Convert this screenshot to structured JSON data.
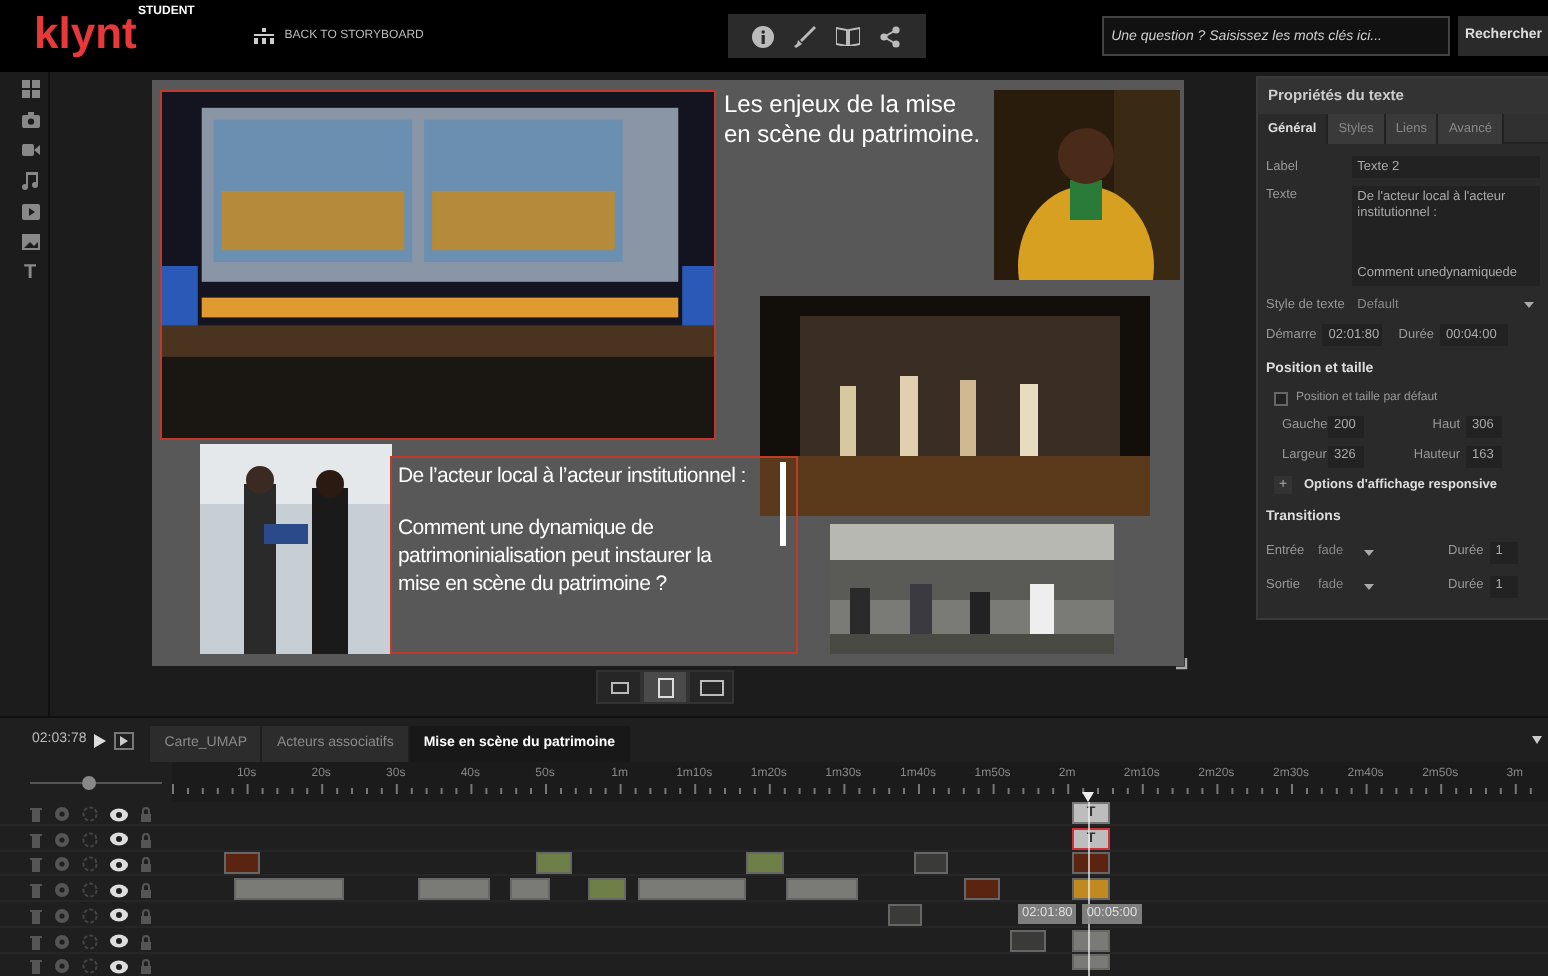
{
  "top_bar": {
    "logo": "klynt",
    "logo_badge": "STUDENT",
    "back_link": "BACK TO STORYBOARD",
    "search": {
      "placeholder": "Une question ? Saisissez les mots clés ici..."
    },
    "search_button": "Rechercher"
  },
  "tool_strip": {
    "text_tool": "T"
  },
  "stage": {
    "title": "Les enjeux de la mise en scène du patrimoine.",
    "text_block": {
      "selected": true,
      "paragraphs": [
        "De l’acteur local à l’acteur institutionnel :",
        "Comment une dynamique de patrimoninialisation peut instaurer la mise en scène du patrimoine ?"
      ]
    },
    "aspect_buttons": [
      {
        "selected": false
      },
      {
        "selected": true
      },
      {
        "selected": false
      }
    ]
  },
  "panel": {
    "title": "Propriétés du texte",
    "tabs": [
      {
        "label": "Général",
        "selected": true
      },
      {
        "label": "Styles",
        "selected": false
      },
      {
        "label": "Liens",
        "selected": false
      },
      {
        "label": "Avancé",
        "selected": false
      }
    ],
    "label": {
      "caption": "Label",
      "value": "Texte 2"
    },
    "text": {
      "caption": "Texte",
      "lines": [
        "De l'acteur local à l'acteur institutionnel :",
        "Comment unedynamiquede"
      ]
    },
    "style": {
      "caption": "Style de texte",
      "value": "Default"
    },
    "start": {
      "caption": "Démarre",
      "value": "02:01:80"
    },
    "duration": {
      "caption": "Durée",
      "value": "00:04:00"
    },
    "position_heading": "Position et taille",
    "default_position": {
      "label": "Position et taille par défaut",
      "checked": false
    },
    "coords": [
      {
        "caption": "Gauche",
        "value": "200"
      },
      {
        "caption": "Haut",
        "value": "306"
      },
      {
        "caption": "Largeur",
        "value": "326"
      },
      {
        "caption": "Hauteur",
        "value": "163"
      }
    ],
    "responsive": {
      "icon": "+",
      "label": "Options d'affichage responsive"
    },
    "transitions_heading": "Transitions",
    "transitions": [
      {
        "caption": "Entrée",
        "value": "fade",
        "duration_caption": "Durée",
        "duration": "1"
      },
      {
        "caption": "Sortie",
        "value": "fade",
        "duration_caption": "Durée",
        "duration": "1"
      }
    ]
  },
  "timeline": {
    "time": "02:03:78",
    "tabs": [
      {
        "label": "Carte_UMAP",
        "selected": false
      },
      {
        "label": "Acteurs associatifs",
        "selected": false
      },
      {
        "label": "Mise en scène du patrimoine",
        "selected": true
      }
    ],
    "zoom": {
      "level": 0.45
    },
    "ruler": [
      "10s",
      "20s",
      "30s",
      "40s",
      "50s",
      "1m",
      "1m10s",
      "1m20s",
      "1m30s",
      "1m40s",
      "1m50s",
      "2m",
      "2m10s",
      "2m20s",
      "2m30s",
      "2m40s",
      "2m50s",
      "3m"
    ],
    "text_clips": [
      {
        "label": "T",
        "selected": false
      },
      {
        "label": "T",
        "selected": true
      }
    ],
    "clip_tooltip": {
      "start": "02:01:80",
      "duration": "00:05:00"
    }
  }
}
